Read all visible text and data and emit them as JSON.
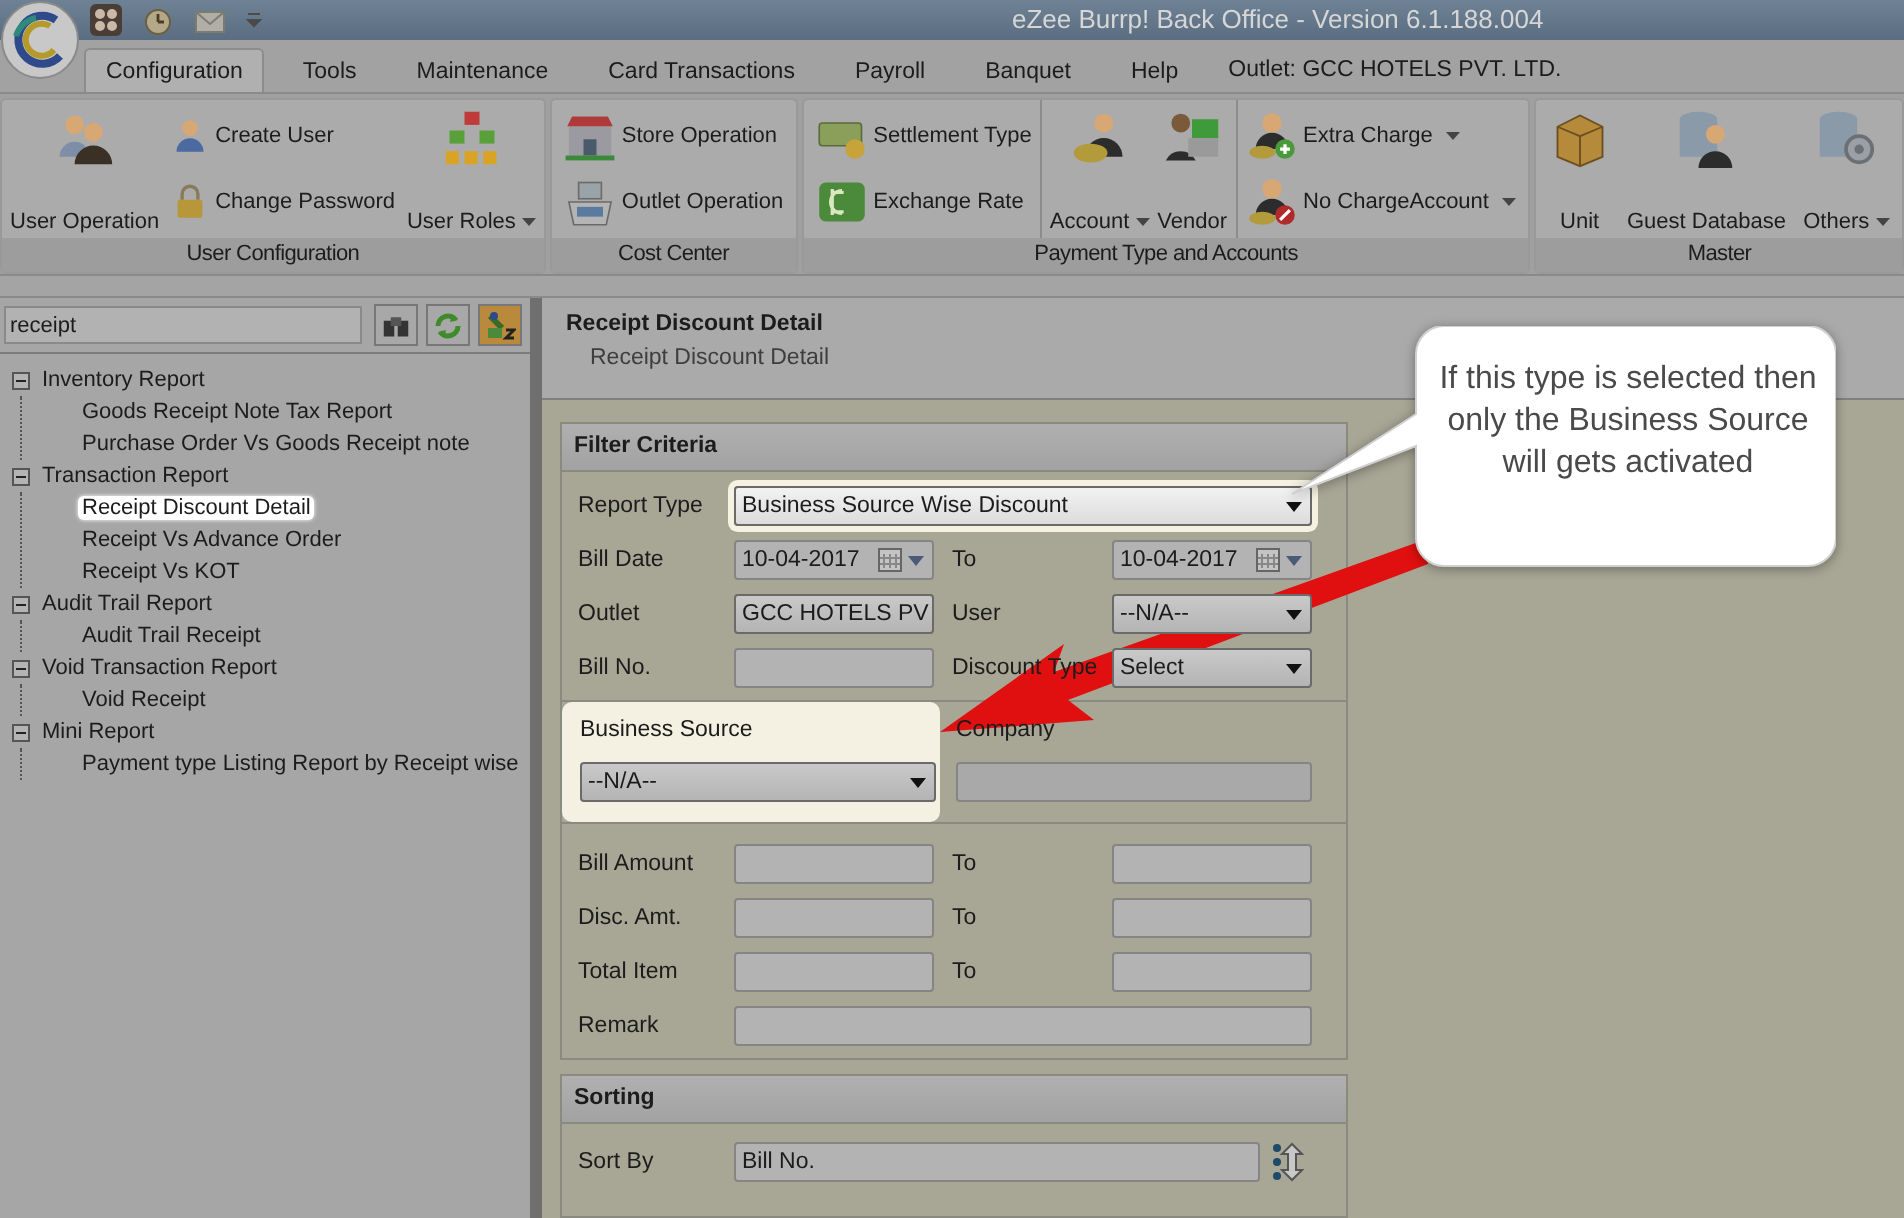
{
  "window": {
    "title": "eZee Burrp! Back Office - Version 6.1.188.004"
  },
  "tabs": [
    {
      "label": "Configuration",
      "selected": true
    },
    {
      "label": "Tools",
      "selected": false
    },
    {
      "label": "Maintenance",
      "selected": false
    },
    {
      "label": "Card Transactions",
      "selected": false
    },
    {
      "label": "Payroll",
      "selected": false
    },
    {
      "label": "Banquet",
      "selected": false
    },
    {
      "label": "Help",
      "selected": false
    }
  ],
  "outlet": "Outlet: GCC HOTELS PVT. LTD.",
  "ribbon": [
    {
      "label": "User Configuration",
      "columns": [
        {
          "kind": "large",
          "label": "User Operation",
          "dropdown": false
        },
        {
          "kind": "stack",
          "items": [
            {
              "label": "Create User",
              "dropdown": false
            },
            {
              "label": "Change Password",
              "dropdown": false
            }
          ]
        },
        {
          "kind": "large",
          "label": "User Roles",
          "dropdown": true
        }
      ]
    },
    {
      "label": "Cost Center",
      "columns": [
        {
          "kind": "wide_stack",
          "items": [
            {
              "label": "Store Operation",
              "dropdown": false
            },
            {
              "label": "Outlet Operation",
              "dropdown": false
            }
          ]
        }
      ]
    },
    {
      "label": "Payment Type and Accounts",
      "columns": [
        {
          "kind": "wide_stack",
          "items": [
            {
              "label": "Settlement Type",
              "dropdown": false
            },
            {
              "label": "Exchange Rate",
              "dropdown": false
            }
          ]
        },
        {
          "kind": "large",
          "label": "Account",
          "dropdown": true
        },
        {
          "kind": "large",
          "label": "Vendor",
          "dropdown": false
        },
        {
          "kind": "wide_stack",
          "items": [
            {
              "label": "Extra Charge",
              "dropdown": true
            },
            {
              "label": "No ChargeAccount",
              "dropdown": true
            }
          ]
        }
      ]
    },
    {
      "label": "Master",
      "columns": [
        {
          "kind": "large",
          "label": "Unit",
          "dropdown": false
        },
        {
          "kind": "large",
          "label": "Guest Database",
          "dropdown": false
        },
        {
          "kind": "large",
          "label": "Others",
          "dropdown": true
        }
      ]
    }
  ],
  "search": {
    "value": "receipt"
  },
  "tree": [
    {
      "label": "Inventory Report",
      "expanded": true,
      "selected": false,
      "children": [
        {
          "label": "Goods Receipt Note Tax Report",
          "selected": false
        },
        {
          "label": "Purchase Order Vs Goods Receipt note",
          "selected": false
        }
      ]
    },
    {
      "label": "Transaction Report",
      "expanded": true,
      "selected": false,
      "children": [
        {
          "label": "Receipt Discount Detail",
          "selected": true
        },
        {
          "label": "Receipt Vs Advance Order",
          "selected": false
        },
        {
          "label": "Receipt Vs KOT",
          "selected": false
        }
      ]
    },
    {
      "label": "Audit Trail Report",
      "expanded": true,
      "selected": false,
      "children": [
        {
          "label": "Audit Trail Receipt",
          "selected": false
        }
      ]
    },
    {
      "label": "Void Transaction Report",
      "expanded": true,
      "selected": false,
      "children": [
        {
          "label": "Void Receipt",
          "selected": false
        }
      ]
    },
    {
      "label": "Mini Report",
      "expanded": true,
      "selected": false,
      "children": [
        {
          "label": "Payment type Listing Report by Receipt wise",
          "selected": false
        }
      ]
    }
  ],
  "report": {
    "title": "Receipt Discount Detail",
    "subtitle": "Receipt Discount Detail"
  },
  "filter": {
    "title": "Filter Criteria",
    "rows": [
      {
        "kind": "full",
        "label": "Report Type",
        "field": {
          "kind": "select",
          "value": "Business Source Wise Discount",
          "highlighted": true
        }
      },
      {
        "kind": "pair",
        "label": "Bill Date",
        "field": {
          "kind": "date",
          "value": "10-04-2017"
        },
        "label2": "To",
        "field2": {
          "kind": "date",
          "value": "10-04-2017"
        }
      },
      {
        "kind": "pair",
        "label": "Outlet",
        "field": {
          "kind": "select",
          "value": "GCC HOTELS PV"
        },
        "label2": "User",
        "field2": {
          "kind": "select",
          "value": "--N/A--"
        }
      },
      {
        "kind": "pair",
        "label": "Bill No.",
        "field": {
          "kind": "text"
        },
        "label2": "Discount Type",
        "field2": {
          "kind": "select",
          "value": "Select"
        }
      }
    ],
    "source": [
      {
        "label": "Business Source",
        "highlighted": true,
        "field": {
          "kind": "select",
          "value": "--N/A--"
        }
      },
      {
        "label": "Company",
        "highlighted": false,
        "field": {
          "kind": "disabled"
        }
      }
    ],
    "amounts": [
      {
        "kind": "pair",
        "label": "Bill Amount",
        "field": {
          "kind": "text"
        },
        "label2": "To",
        "field2": {
          "kind": "text"
        }
      },
      {
        "kind": "pair",
        "label": "Disc. Amt.",
        "field": {
          "kind": "text"
        },
        "label2": "To",
        "field2": {
          "kind": "text"
        }
      },
      {
        "kind": "pair",
        "label": "Total Item",
        "field": {
          "kind": "text"
        },
        "label2": "To",
        "field2": {
          "kind": "text"
        }
      },
      {
        "kind": "full",
        "label": "Remark",
        "field": {
          "kind": "text"
        }
      }
    ]
  },
  "sorting": {
    "title": "Sorting",
    "label": "Sort By",
    "value": "Bill No."
  },
  "callout": {
    "text": "If this type is selected then only the Business Source will gets activated"
  }
}
